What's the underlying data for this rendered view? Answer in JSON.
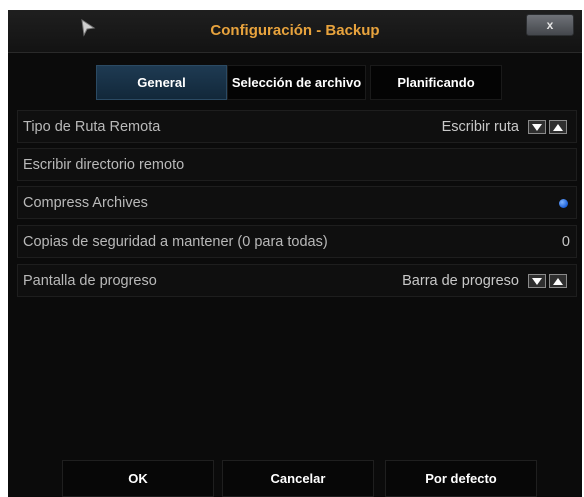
{
  "dialog": {
    "title": "Configuración - Backup",
    "close_label": "x"
  },
  "tabs": [
    {
      "label": "General",
      "active": true
    },
    {
      "label": "Selección de archivo",
      "active": false
    },
    {
      "label": "Planificando",
      "active": false
    }
  ],
  "settings": [
    {
      "label": "Tipo de Ruta Remota",
      "value": "Escribir ruta",
      "control": "spinner"
    },
    {
      "label": "Escribir directorio remoto",
      "value": "",
      "control": "none"
    },
    {
      "label": "Compress Archives",
      "value": "",
      "control": "radio",
      "checked": true
    },
    {
      "label": "Copias de seguridad a mantener (0 para todas)",
      "value": "0",
      "control": "text"
    },
    {
      "label": "Pantalla de progreso",
      "value": "Barra de progreso",
      "control": "spinner"
    }
  ],
  "buttons": {
    "ok": "OK",
    "cancel": "Cancelar",
    "default": "Por defecto"
  },
  "colors": {
    "title": "#e8a33d",
    "active_tab": "#1e3a52",
    "radio_on": "#1a5fd8"
  }
}
